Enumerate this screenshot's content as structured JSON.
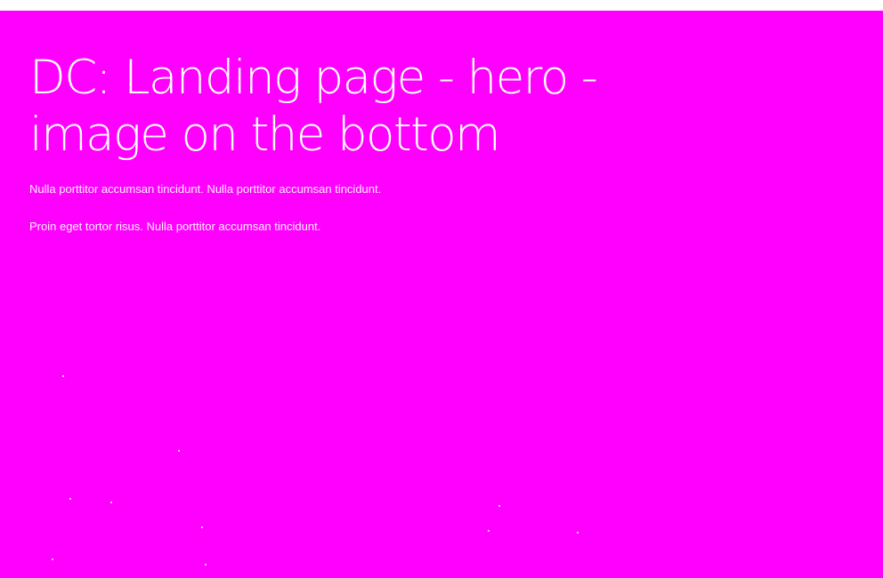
{
  "colors": {
    "hero_background": "#ff00ff",
    "text": "#ffffff",
    "page_background": "#ffffff"
  },
  "hero": {
    "title_line1": "DC: Landing page - hero -",
    "title_line2": "image on the bottom",
    "paragraph1": "Nulla porttitor accumsan tincidunt. Nulla porttitor accumsan tincidunt.",
    "paragraph2": "Proin eget tortor risus. Nulla porttitor accumsan tincidunt."
  }
}
